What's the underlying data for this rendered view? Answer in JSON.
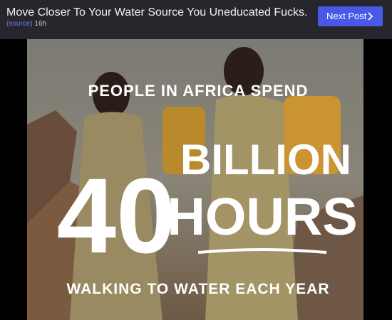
{
  "post": {
    "title": "Move Closer To Your Water Source You Uneducated Fucks.",
    "source_label": "(source)",
    "age": "16h"
  },
  "nav": {
    "next_label": "Next Post",
    "next_icon": "chevron-right-icon"
  },
  "image": {
    "line1": "PEOPLE IN AFRICA SPEND",
    "number": "40",
    "word1": "BILLION",
    "word2": "HOURS",
    "line3": "WALKING TO WATER EACH YEAR"
  },
  "colors": {
    "topbar": "#26262c",
    "accent": "#4759e6",
    "link": "#6f7ee8"
  }
}
